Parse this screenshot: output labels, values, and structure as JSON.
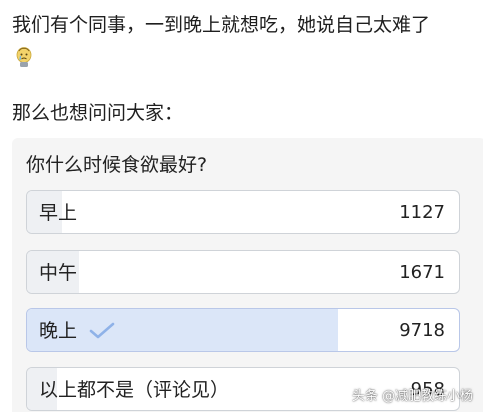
{
  "post": {
    "intro_text": "我们有个同事，一到晚上就想吃，她说自己太难了",
    "emoji_icon": "crying-face-icon",
    "question_intro": "那么也想问问大家："
  },
  "poll": {
    "title": "你什么时候食欲最好?",
    "options": [
      {
        "label": "早上",
        "count": "1127",
        "share": 0.08,
        "selected": false
      },
      {
        "label": "中午",
        "count": "1671",
        "share": 0.12,
        "selected": false
      },
      {
        "label": "晚上",
        "count": "9718",
        "share": 0.72,
        "selected": true
      },
      {
        "label": "以上都不是（评论见）",
        "count": "958",
        "share": 0.07,
        "selected": false
      }
    ],
    "accent_color": "#8fb2e8"
  },
  "watermark": {
    "text": "头条 @减肥教练小杨"
  }
}
